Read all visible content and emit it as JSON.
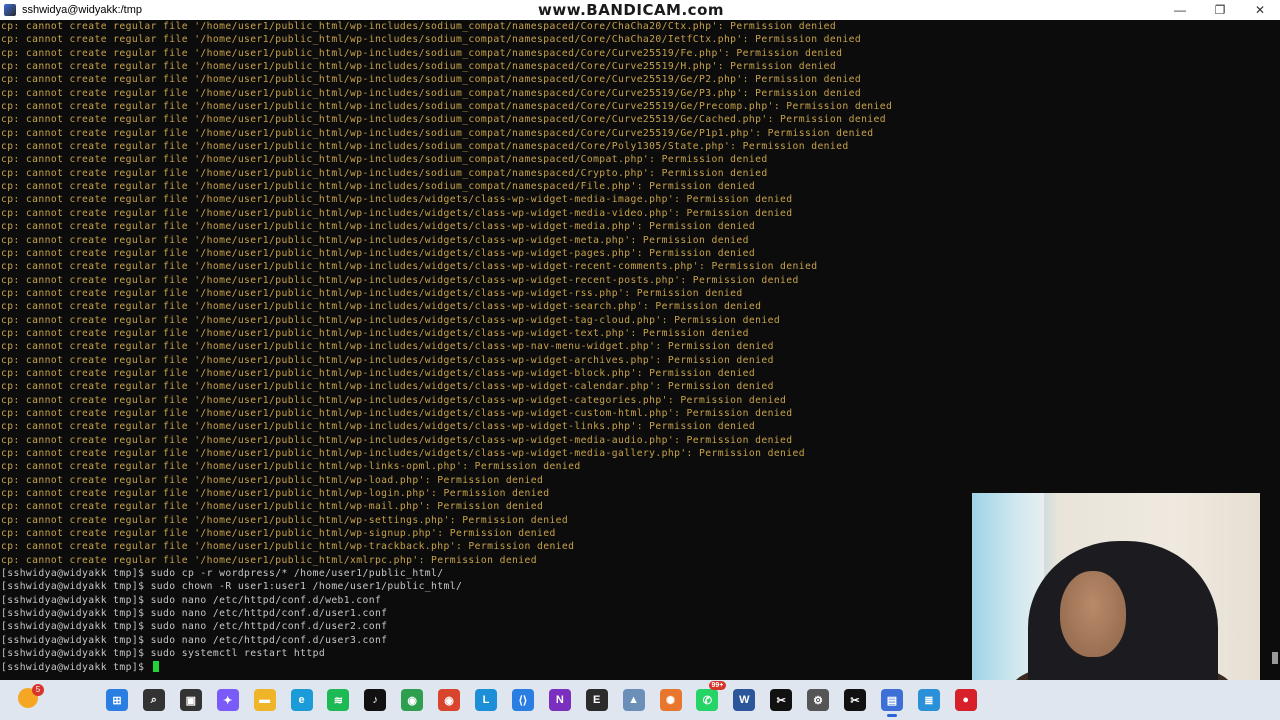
{
  "window": {
    "title": "sshwidya@widyakk:/tmp",
    "watermark": "www.BANDICAM.com",
    "controls": {
      "minimize": "—",
      "maximize": "❐",
      "close": "✕"
    }
  },
  "terminal": {
    "error_lines": [
      "cp: cannot create regular file '/home/user1/public_html/wp-includes/sodium_compat/namespaced/Core/ChaCha20/Ctx.php': Permission denied",
      "cp: cannot create regular file '/home/user1/public_html/wp-includes/sodium_compat/namespaced/Core/ChaCha20/IetfCtx.php': Permission denied",
      "cp: cannot create regular file '/home/user1/public_html/wp-includes/sodium_compat/namespaced/Core/Curve25519/Fe.php': Permission denied",
      "cp: cannot create regular file '/home/user1/public_html/wp-includes/sodium_compat/namespaced/Core/Curve25519/H.php': Permission denied",
      "cp: cannot create regular file '/home/user1/public_html/wp-includes/sodium_compat/namespaced/Core/Curve25519/Ge/P2.php': Permission denied",
      "cp: cannot create regular file '/home/user1/public_html/wp-includes/sodium_compat/namespaced/Core/Curve25519/Ge/P3.php': Permission denied",
      "cp: cannot create regular file '/home/user1/public_html/wp-includes/sodium_compat/namespaced/Core/Curve25519/Ge/Precomp.php': Permission denied",
      "cp: cannot create regular file '/home/user1/public_html/wp-includes/sodium_compat/namespaced/Core/Curve25519/Ge/Cached.php': Permission denied",
      "cp: cannot create regular file '/home/user1/public_html/wp-includes/sodium_compat/namespaced/Core/Curve25519/Ge/P1p1.php': Permission denied",
      "cp: cannot create regular file '/home/user1/public_html/wp-includes/sodium_compat/namespaced/Core/Poly1305/State.php': Permission denied",
      "cp: cannot create regular file '/home/user1/public_html/wp-includes/sodium_compat/namespaced/Compat.php': Permission denied",
      "cp: cannot create regular file '/home/user1/public_html/wp-includes/sodium_compat/namespaced/Crypto.php': Permission denied",
      "cp: cannot create regular file '/home/user1/public_html/wp-includes/sodium_compat/namespaced/File.php': Permission denied",
      "cp: cannot create regular file '/home/user1/public_html/wp-includes/widgets/class-wp-widget-media-image.php': Permission denied",
      "cp: cannot create regular file '/home/user1/public_html/wp-includes/widgets/class-wp-widget-media-video.php': Permission denied",
      "cp: cannot create regular file '/home/user1/public_html/wp-includes/widgets/class-wp-widget-media.php': Permission denied",
      "cp: cannot create regular file '/home/user1/public_html/wp-includes/widgets/class-wp-widget-meta.php': Permission denied",
      "cp: cannot create regular file '/home/user1/public_html/wp-includes/widgets/class-wp-widget-pages.php': Permission denied",
      "cp: cannot create regular file '/home/user1/public_html/wp-includes/widgets/class-wp-widget-recent-comments.php': Permission denied",
      "cp: cannot create regular file '/home/user1/public_html/wp-includes/widgets/class-wp-widget-recent-posts.php': Permission denied",
      "cp: cannot create regular file '/home/user1/public_html/wp-includes/widgets/class-wp-widget-rss.php': Permission denied",
      "cp: cannot create regular file '/home/user1/public_html/wp-includes/widgets/class-wp-widget-search.php': Permission denied",
      "cp: cannot create regular file '/home/user1/public_html/wp-includes/widgets/class-wp-widget-tag-cloud.php': Permission denied",
      "cp: cannot create regular file '/home/user1/public_html/wp-includes/widgets/class-wp-widget-text.php': Permission denied",
      "cp: cannot create regular file '/home/user1/public_html/wp-includes/widgets/class-wp-nav-menu-widget.php': Permission denied",
      "cp: cannot create regular file '/home/user1/public_html/wp-includes/widgets/class-wp-widget-archives.php': Permission denied",
      "cp: cannot create regular file '/home/user1/public_html/wp-includes/widgets/class-wp-widget-block.php': Permission denied",
      "cp: cannot create regular file '/home/user1/public_html/wp-includes/widgets/class-wp-widget-calendar.php': Permission denied",
      "cp: cannot create regular file '/home/user1/public_html/wp-includes/widgets/class-wp-widget-categories.php': Permission denied",
      "cp: cannot create regular file '/home/user1/public_html/wp-includes/widgets/class-wp-widget-custom-html.php': Permission denied",
      "cp: cannot create regular file '/home/user1/public_html/wp-includes/widgets/class-wp-widget-links.php': Permission denied",
      "cp: cannot create regular file '/home/user1/public_html/wp-includes/widgets/class-wp-widget-media-audio.php': Permission denied",
      "cp: cannot create regular file '/home/user1/public_html/wp-includes/widgets/class-wp-widget-media-gallery.php': Permission denied",
      "cp: cannot create regular file '/home/user1/public_html/wp-links-opml.php': Permission denied",
      "cp: cannot create regular file '/home/user1/public_html/wp-load.php': Permission denied",
      "cp: cannot create regular file '/home/user1/public_html/wp-login.php': Permission denied",
      "cp: cannot create regular file '/home/user1/public_html/wp-mail.php': Permission denied",
      "cp: cannot create regular file '/home/user1/public_html/wp-settings.php': Permission denied",
      "cp: cannot create regular file '/home/user1/public_html/wp-signup.php': Permission denied",
      "cp: cannot create regular file '/home/user1/public_html/wp-trackback.php': Permission denied",
      "cp: cannot create regular file '/home/user1/public_html/xmlrpc.php': Permission denied"
    ],
    "prompt_lines": [
      "[sshwidya@widyakk tmp]$ sudo cp -r wordpress/* /home/user1/public_html/",
      "[sshwidya@widyakk tmp]$ sudo chown -R user1:user1 /home/user1/public_html/",
      "[sshwidya@widyakk tmp]$ sudo nano /etc/httpd/conf.d/web1.conf",
      "[sshwidya@widyakk tmp]$ sudo nano /etc/httpd/conf.d/user1.conf",
      "[sshwidya@widyakk tmp]$ sudo nano /etc/httpd/conf.d/user2.conf",
      "[sshwidya@widyakk tmp]$ sudo nano /etc/httpd/conf.d/user3.conf",
      "[sshwidya@widyakk tmp]$ sudo systemctl restart httpd"
    ],
    "current_prompt": "[sshwidya@widyakk tmp]$ ",
    "error_color": "#c7a24a",
    "prompt_color": "#c7c7c7",
    "cursor_color": "#22d33a"
  },
  "taskbar": {
    "weather_badge": "5",
    "items": [
      {
        "name": "start",
        "glyph": "⊞",
        "color": "#2a7de1"
      },
      {
        "name": "search",
        "glyph": "⌕",
        "color": "#333333"
      },
      {
        "name": "task-view",
        "glyph": "▣",
        "color": "#333333"
      },
      {
        "name": "copilot",
        "glyph": "✦",
        "color": "#7a5af8"
      },
      {
        "name": "file-explorer",
        "glyph": "▬",
        "color": "#f0b429"
      },
      {
        "name": "edge",
        "glyph": "e",
        "color": "#1b9bd8"
      },
      {
        "name": "spotify",
        "glyph": "≋",
        "color": "#1db954"
      },
      {
        "name": "tiktok",
        "glyph": "♪",
        "color": "#111111"
      },
      {
        "name": "chrome",
        "glyph": "◉",
        "color": "#2e9e4f"
      },
      {
        "name": "chrome-profile",
        "glyph": "◉",
        "color": "#d9442c"
      },
      {
        "name": "lexicon",
        "glyph": "L",
        "color": "#1d8fd9"
      },
      {
        "name": "vscode",
        "glyph": "⟨⟩",
        "color": "#2a7de1"
      },
      {
        "name": "onenote",
        "glyph": "N",
        "color": "#7b2fbf"
      },
      {
        "name": "epic-games",
        "glyph": "E",
        "color": "#2b2b2b"
      },
      {
        "name": "photos",
        "glyph": "▲",
        "color": "#6b8fb8"
      },
      {
        "name": "pinwheel",
        "glyph": "✺",
        "color": "#e8762c"
      },
      {
        "name": "whatsapp",
        "glyph": "✆",
        "color": "#25d366",
        "badge": "99+"
      },
      {
        "name": "word",
        "glyph": "W",
        "color": "#2b579a"
      },
      {
        "name": "capcut",
        "glyph": "✂",
        "color": "#111111"
      },
      {
        "name": "settings",
        "glyph": "⚙",
        "color": "#555555"
      },
      {
        "name": "capcut-2",
        "glyph": "✂",
        "color": "#111111"
      },
      {
        "name": "terminal-app",
        "glyph": "▤",
        "color": "#3d6fd6",
        "active": true
      },
      {
        "name": "notepad",
        "glyph": "≣",
        "color": "#2a90d8"
      },
      {
        "name": "bandicam",
        "glyph": "●",
        "color": "#d8202a"
      }
    ]
  }
}
